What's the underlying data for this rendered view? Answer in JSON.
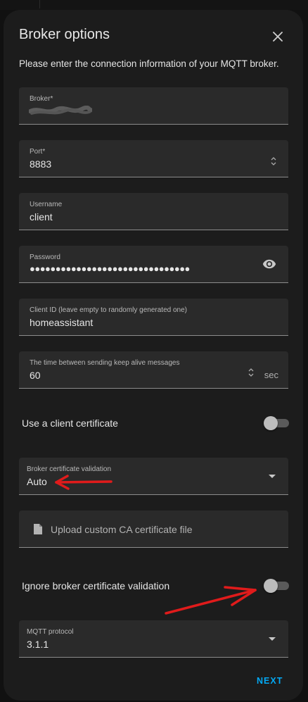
{
  "dialog": {
    "title": "Broker options",
    "subtitle": "Please enter the connection information of your MQTT broker.",
    "close_icon": "close-icon"
  },
  "fields": {
    "broker": {
      "label": "Broker*",
      "value": ""
    },
    "port": {
      "label": "Port*",
      "value": "8883"
    },
    "username": {
      "label": "Username",
      "value": "client"
    },
    "password": {
      "label": "Password",
      "value": "●●●●●●●●●●●●●●●●●●●●●●●●●●●●●●●",
      "toggle_icon": "eye-icon"
    },
    "client_id": {
      "label": "Client ID (leave empty to randomly generated one)",
      "value": "homeassistant"
    },
    "keepalive": {
      "label": "The time between sending keep alive messages",
      "value": "60",
      "suffix": "sec"
    },
    "cert_validation": {
      "label": "Broker certificate validation",
      "value": "Auto"
    },
    "upload": {
      "label": "Upload custom CA certificate file",
      "icon": "file-icon"
    },
    "protocol": {
      "label": "MQTT protocol",
      "value": "3.1.1"
    }
  },
  "toggles": {
    "client_cert": {
      "label": "Use a client certificate",
      "on": false
    },
    "ignore_validation": {
      "label": "Ignore broker certificate validation",
      "on": false
    }
  },
  "actions": {
    "next_label": "NEXT"
  },
  "colors": {
    "accent": "#03a9f4",
    "annotation": "#e01b1b",
    "surface": "#1c1c1c",
    "field": "#2a2a2a"
  }
}
